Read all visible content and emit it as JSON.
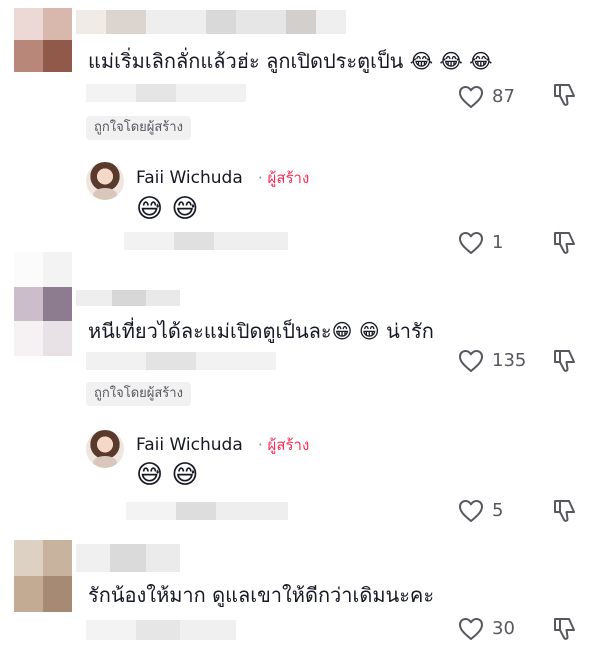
{
  "comments": [
    {
      "text": "แม่เริ่มเลิกลั่กแล้วฮ่ะ ลูกเปิดประตูเป็น 😂 😂 😂",
      "likes": "87",
      "liked_by_creator": "ถูกใจโดยผู้สร้าง",
      "reply": {
        "author": "Faii Wichuda",
        "creator_label": "ผู้สร้าง",
        "text": "😅 😅",
        "likes": "1"
      }
    },
    {
      "text": "หนีเที่ยวได้ละแม่เปิดตูเป็นละ😁 😁  น่ารัก",
      "likes": "135",
      "liked_by_creator": "ถูกใจโดยผู้สร้าง",
      "reply": {
        "author": "Faii Wichuda",
        "creator_label": "ผู้สร้าง",
        "text": "😅 😅",
        "likes": "5"
      }
    },
    {
      "text": "รักน้องให้มาก ดูแลเขาให้ดีกว่าเดิมนะคะ",
      "likes": "30"
    }
  ],
  "colors": {
    "creator_accent": "#fe2c55",
    "secondary_text": "#57585f"
  }
}
